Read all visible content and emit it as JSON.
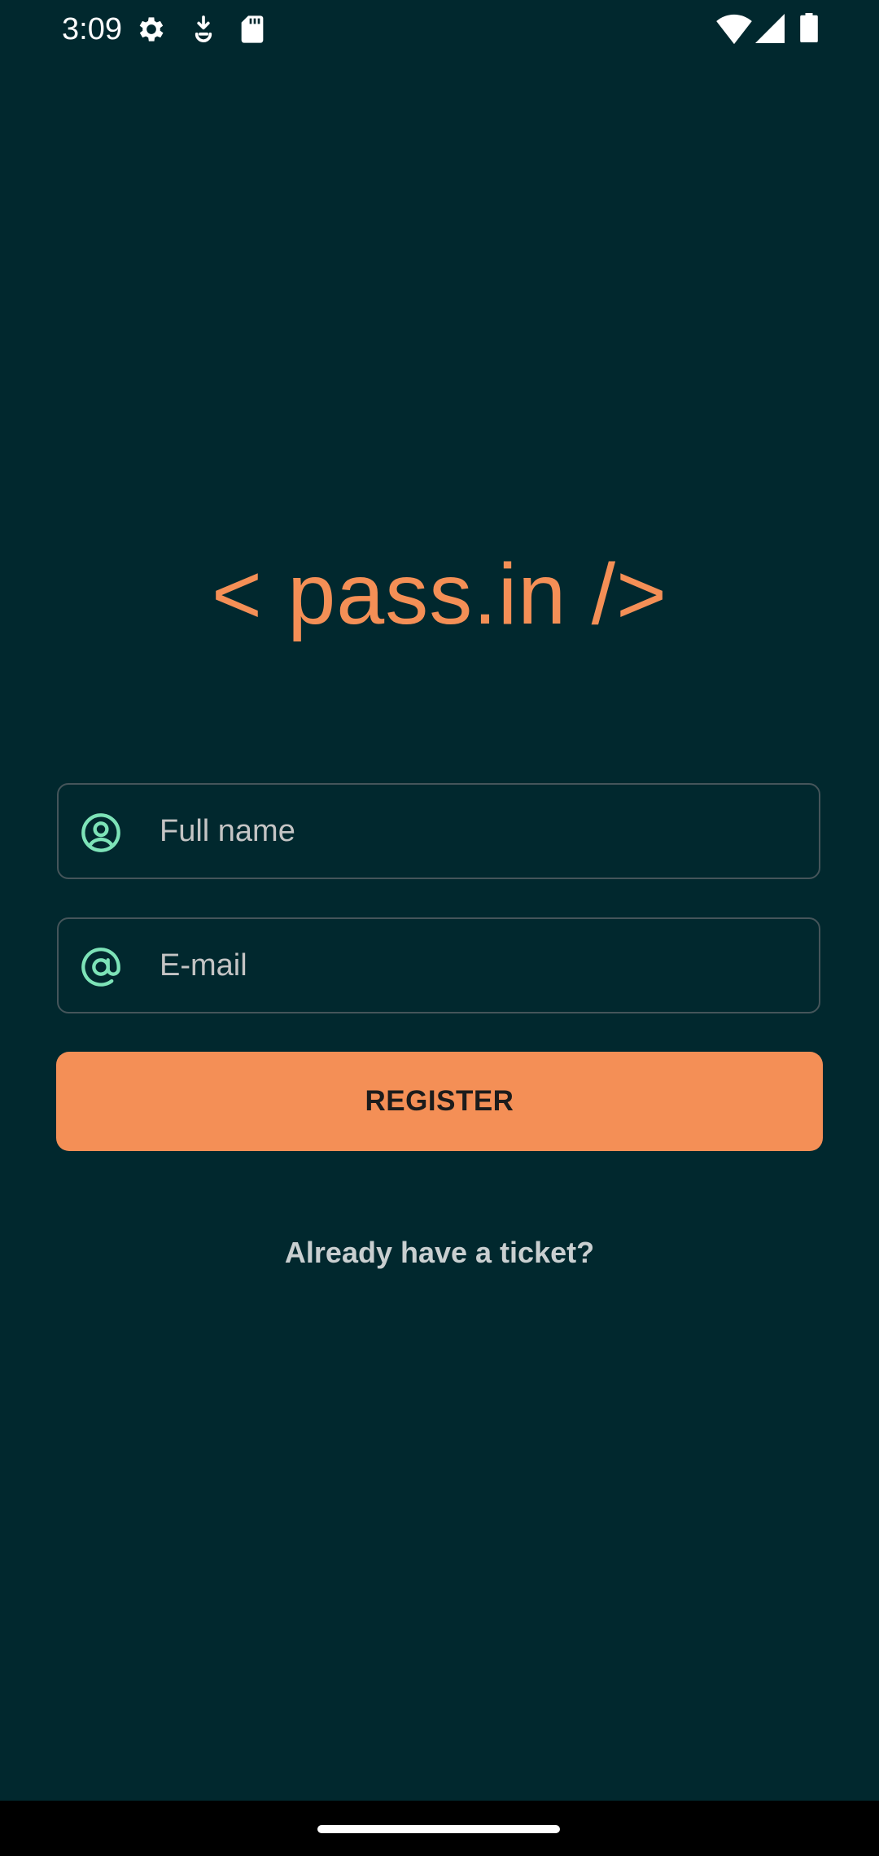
{
  "status_bar": {
    "time": "3:09",
    "left_icons": [
      "gear-icon",
      "download-icon",
      "sd-card-icon"
    ],
    "right_icons": [
      "wifi-icon",
      "signal-icon",
      "battery-icon"
    ]
  },
  "app": {
    "logo_text": "< pass.in />",
    "colors": {
      "background": "#01282e",
      "accent": "#f48f56",
      "icon": "#7de3b8",
      "border": "#45555a"
    }
  },
  "form": {
    "name_field": {
      "icon": "user-circle-icon",
      "placeholder": "Full name",
      "value": ""
    },
    "email_field": {
      "icon": "at-sign-icon",
      "placeholder": "E-mail",
      "value": ""
    },
    "register_label": "REGISTER",
    "ticket_link_label": "Already have a ticket?"
  }
}
